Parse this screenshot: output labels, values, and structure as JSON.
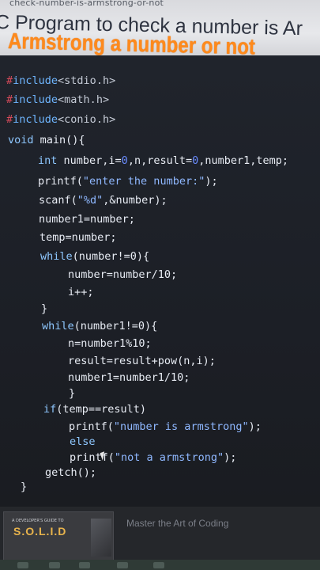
{
  "browser": {
    "url_text": "check-number-is-armstrong-or-not"
  },
  "heading": {
    "line1": "C Program to check a number is Ar",
    "line2": "Armstrong a number or not"
  },
  "code": {
    "l1": {
      "hash": "#",
      "word": "include",
      "header": "<stdio.h>"
    },
    "l2": {
      "hash": "#",
      "word": "include",
      "header": "<math.h>"
    },
    "l3": {
      "hash": "#",
      "word": "include",
      "header": "<conio.h>"
    },
    "l4": {
      "kw": "void",
      "rest": " main(){"
    },
    "l5": {
      "kw": "int",
      "a": " number,i=",
      "n1": "0",
      "b": ",n,result=",
      "n2": "0",
      "c": ",number1,temp;"
    },
    "l6": {
      "fn": "printf(",
      "str": "\"enter the number:\"",
      "end": ");"
    },
    "l7": {
      "fn": "scanf(",
      "str": "\"%d\"",
      "end": ",&number);"
    },
    "l8": "number1=number;",
    "l9": "temp=number;",
    "l10": {
      "kw": "while",
      "rest": "(number!=0){"
    },
    "l11": "number=number/10;",
    "l12": "i++;",
    "l13": "}",
    "l14": {
      "kw": "while",
      "rest": "(number1!=0){"
    },
    "l15": "n=number1%10;",
    "l16": "result=result+pow(n,i);",
    "l17": "number1=number1/10;",
    "l18": "}",
    "l19": {
      "kw": "if",
      "rest": "(temp==result)"
    },
    "l20": {
      "fn": "printf(",
      "str": "\"number is armstrong\"",
      "end": ");"
    },
    "l21": "else",
    "l22": {
      "fn": "printf(",
      "str": "\"not a armstrong\"",
      "end": ");"
    },
    "l23": "getch();",
    "l24": "}"
  },
  "ad": {
    "small_text": "A DEVELOPER'S GUIDE TO",
    "book_title": "S.O.L.I.D",
    "tagline": "Master the Art of Coding"
  },
  "colors": {
    "heading_accent": "#ff8a1c",
    "editor_bg": "#1e2128",
    "preprocessor": "#d64a5a",
    "keyword": "#8ec7ff"
  }
}
